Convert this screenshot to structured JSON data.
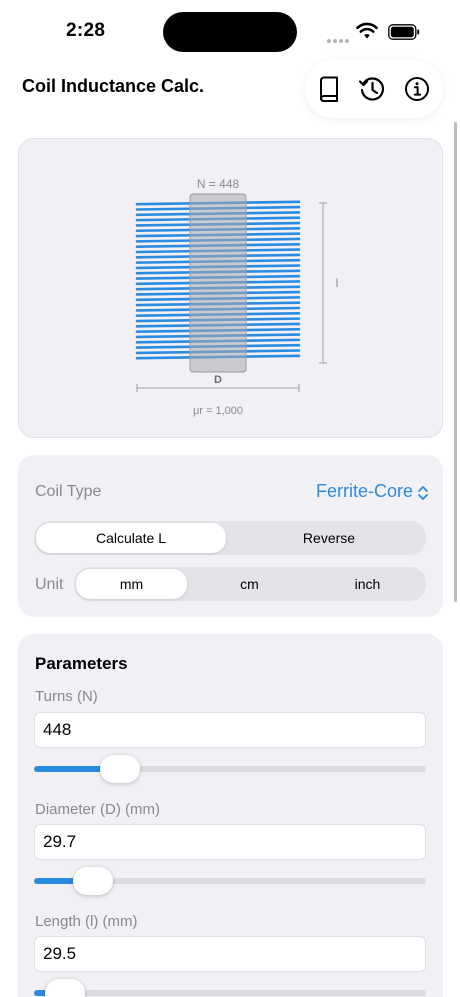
{
  "status": {
    "time": "2:28"
  },
  "header": {
    "title": "Coil Inductance Calc."
  },
  "toolbar": {
    "icons": [
      "book-icon",
      "history-icon",
      "info-icon"
    ]
  },
  "diagram": {
    "turns_label": "N = 448",
    "length_label": "l",
    "diameter_label": "D",
    "permeability_label": "μr = 1,000",
    "wire_color": "#2a8be0",
    "core_color": "#a9a9b1"
  },
  "settings": {
    "coil_type_label": "Coil Type",
    "coil_type_value": "Ferrite-Core",
    "mode_options": [
      "Calculate L",
      "Reverse"
    ],
    "mode_selected": "Calculate L",
    "unit_label": "Unit",
    "unit_options": [
      "mm",
      "cm",
      "inch"
    ],
    "unit_selected": "mm"
  },
  "parameters": {
    "title": "Parameters",
    "fields": [
      {
        "label": "Turns (N)",
        "value": "448",
        "slider_fraction": 0.22
      },
      {
        "label": "Diameter (D) (mm)",
        "value": "29.7",
        "slider_fraction": 0.15
      },
      {
        "label": "Length (l) (mm)",
        "value": "29.5",
        "slider_fraction": 0.08
      }
    ]
  },
  "colors": {
    "accent": "#2a8be0",
    "card_bg": "#f1f1f5"
  }
}
